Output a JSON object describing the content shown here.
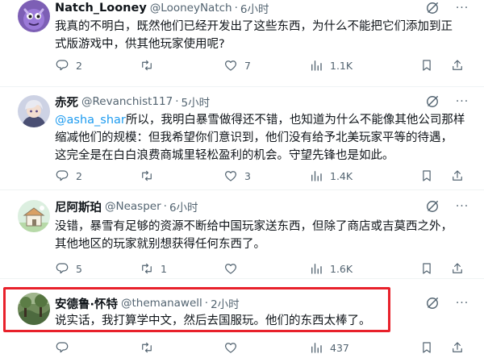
{
  "tweets": [
    {
      "name": "Natch_Looney",
      "handle": "@LooneyNatch",
      "dot": "·",
      "time": "6小时",
      "avatar_icon": "purple-creature-avatar",
      "body_lines": [
        "我真的不明白，既然他们已经开发出了这些东西，为什么不能把它们添加到正",
        "式版游戏中，供其他玩家使用呢?"
      ],
      "replies": "2",
      "retweets": "",
      "likes": "7",
      "views": "1.1K"
    },
    {
      "name": "赤死",
      "handle": "@Revanchist117",
      "dot": "·",
      "time": "5小时",
      "avatar_icon": "anime-character-avatar",
      "mention": "@asha_shar",
      "body_first_rest": "所以，我明白暴雪做得还不错，也知道为什么不能像其他公司那样",
      "body_lines": [
        "缩减他们的规模：但我希望你们意识到，他们没有给予北美玩家平等的待遇，",
        "这完全是在白白浪费商城里轻松盈利的机会。守望先锋也是如此。"
      ],
      "replies": "2",
      "retweets": "",
      "likes": "3",
      "views": "1.4K"
    },
    {
      "name": "尼阿斯珀",
      "handle": "@Neasper",
      "dot": "·",
      "time": "6小时",
      "avatar_icon": "cartoon-house-avatar",
      "body_lines": [
        "没错，暴雪有足够的资源不断给中国玩家送东西，但除了商店或吉莫西之外，",
        "其他地区的玩家就别想获得任何东西了。"
      ],
      "replies": "5",
      "retweets": "1",
      "likes": "",
      "views": "1.6K"
    },
    {
      "name": "安德鲁·怀特",
      "handle": "@themanawell",
      "dot": "·",
      "time": "2小时",
      "avatar_icon": "forest-photo-avatar",
      "body_lines": [
        "说实话，我打算学中文，然后去国服玩。他们的东西太棒了。"
      ],
      "replies": "",
      "retweets": "",
      "likes": "",
      "views": "437"
    }
  ],
  "colors": {
    "accent": "#1d9bf0",
    "muted": "#536471",
    "highlight": "#e8212b"
  }
}
